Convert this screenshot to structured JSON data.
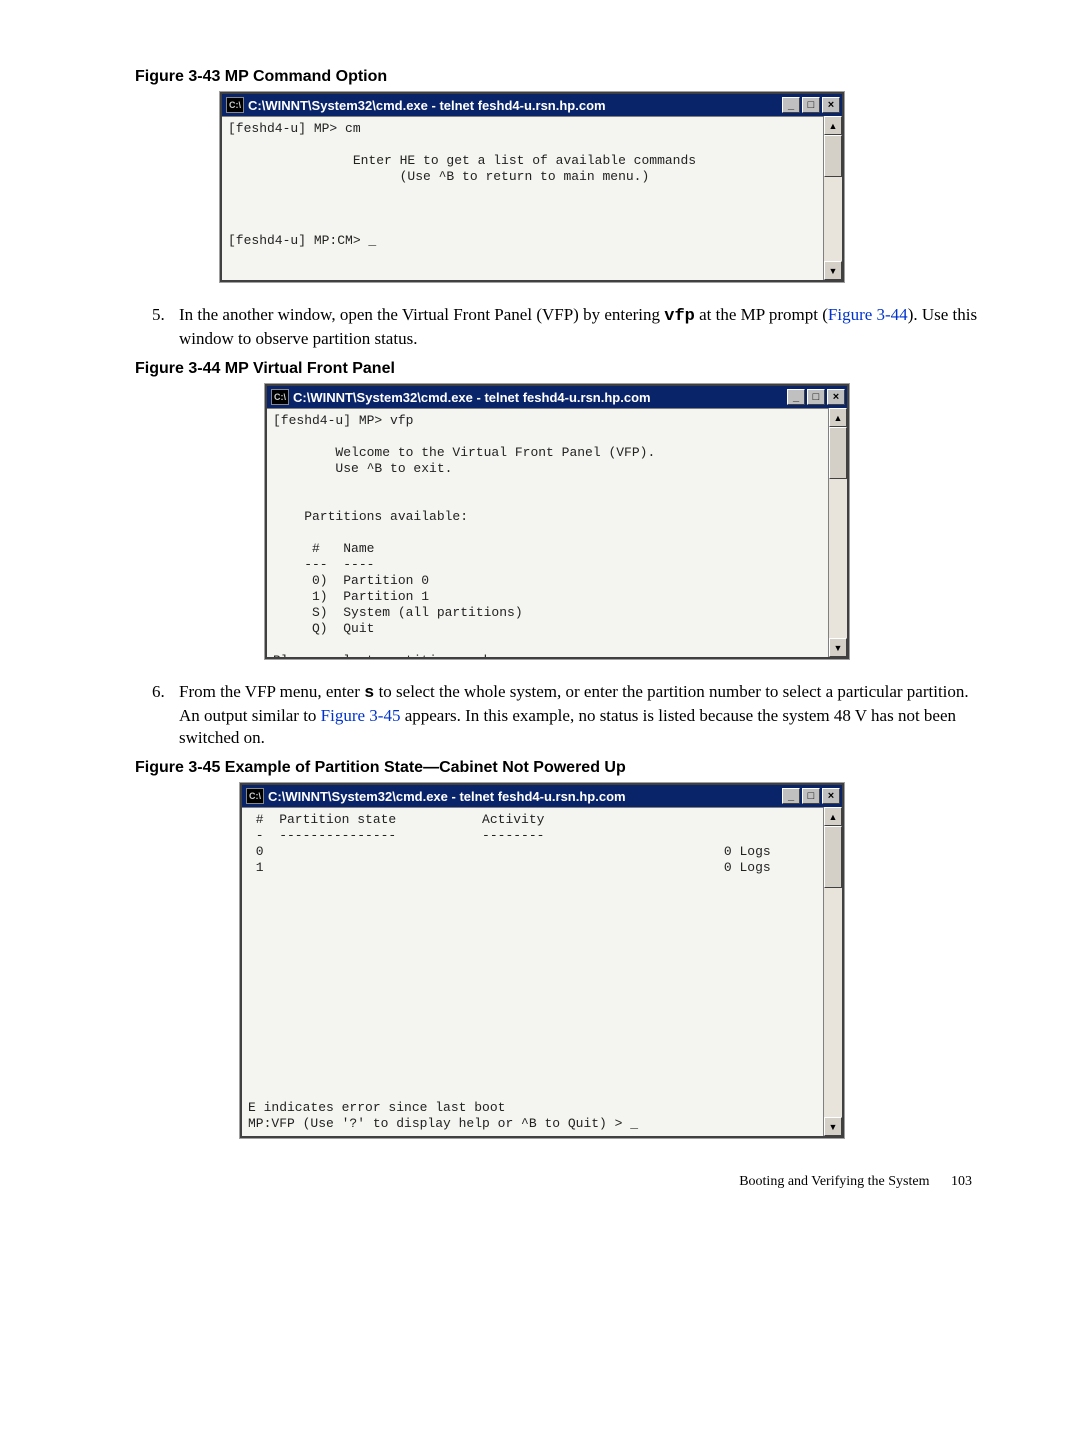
{
  "fig43": {
    "caption": "Figure 3-43  MP Command Option",
    "title": "C:\\WINNT\\System32\\cmd.exe - telnet feshd4-u.rsn.hp.com",
    "content": "[feshd4-u] MP> cm\n\n                Enter HE to get a list of available commands\n                      (Use ^B to return to main menu.)\n\n\n\n[feshd4-u] MP:CM> _"
  },
  "step5": {
    "text_a": "In the another window, open the Virtual Front Panel (VFP) by entering ",
    "cmd": "vfp",
    "text_b": " at the MP prompt (",
    "link": "Figure 3-44",
    "text_c": "). Use this window to observe partition status."
  },
  "fig44": {
    "caption": "Figure 3-44  MP Virtual Front Panel",
    "title": "C:\\WINNT\\System32\\cmd.exe - telnet feshd4-u.rsn.hp.com",
    "content": "[feshd4-u] MP> vfp\n\n        Welcome to the Virtual Front Panel (VFP).\n        Use ^B to exit.\n\n\n    Partitions available:\n\n     #   Name\n    ---  ----\n     0)  Partition 0\n     1)  Partition 1\n     S)  System (all partitions)\n     Q)  Quit\n\nPlease select partition number: _"
  },
  "step6": {
    "text_a": "From the VFP menu, enter ",
    "cmd": "s",
    "text_b": " to select the whole system, or enter the partition number to select a particular partition. An output similar to ",
    "link": "Figure 3-45",
    "text_c": " appears. In this example, no status is listed because the system 48 V has not been switched on."
  },
  "fig45": {
    "caption": "Figure 3-45  Example of Partition State—Cabinet Not Powered Up",
    "title": "C:\\WINNT\\System32\\cmd.exe - telnet feshd4-u.rsn.hp.com",
    "content": " #  Partition state           Activity\n -  ---------------           --------\n 0                                                           0 Logs\n 1                                                           0 Logs\n\n\n\n\n\n\n\n\n\n\n\n\n\n\nE indicates error since last boot\nMP:VFP (Use '?' to display help or ^B to Quit) > _"
  },
  "winctrl": {
    "icon": "C:\\",
    "min": "_",
    "max": "□",
    "close": "×",
    "up": "▲",
    "down": "▼"
  },
  "footer": {
    "section": "Booting and Verifying the System",
    "page": "103"
  }
}
